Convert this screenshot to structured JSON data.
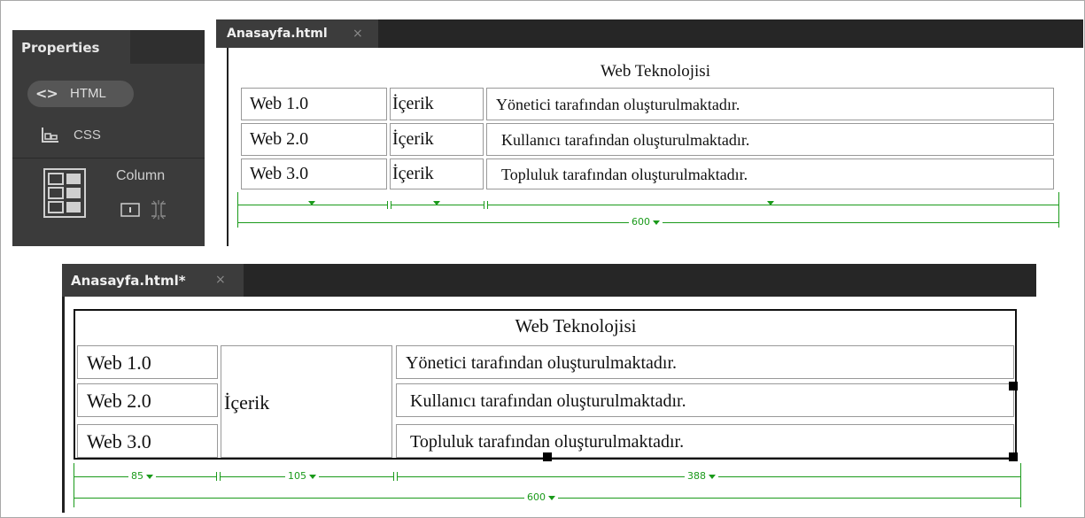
{
  "properties_panel": {
    "tab_label": "Properties",
    "html_button": {
      "icon": "<>",
      "label": "HTML"
    },
    "css_button": {
      "label": "CSS"
    },
    "column_label": "Column"
  },
  "editor_top": {
    "tab_title": "Anasayfa.html",
    "close_glyph": "×",
    "table": {
      "title": "Web Teknolojisi",
      "rows": [
        [
          "Web 1.0",
          "İçerik",
          "Yönetici tarafından oluşturulmaktadır."
        ],
        [
          "Web 2.0",
          "İçerik",
          "Kullanıcı tarafından oluşturulmaktadır."
        ],
        [
          "Web 3.0",
          "İçerik",
          "Topluluk tarafından oluşturulmaktadır."
        ]
      ],
      "total_width_label": "600"
    }
  },
  "editor_bottom": {
    "tab_title": "Anasayfa.html*",
    "close_glyph": "×",
    "table": {
      "title": "Web Teknolojisi",
      "col1": [
        "Web 1.0",
        "Web 2.0",
        "Web 3.0"
      ],
      "merged_col2": "İçerik",
      "col3": [
        "Yönetici tarafından oluşturulmaktadır.",
        "Kullanıcı tarafından oluşturulmaktadır.",
        "Topluluk tarafından oluşturulmaktadır."
      ],
      "column_widths": [
        "85",
        "105",
        "388"
      ],
      "total_width_label": "600"
    }
  },
  "colors": {
    "panel_bg": "#3b3b3b",
    "tabbar_bg": "#262626",
    "guide_green": "#1a9a1a"
  }
}
